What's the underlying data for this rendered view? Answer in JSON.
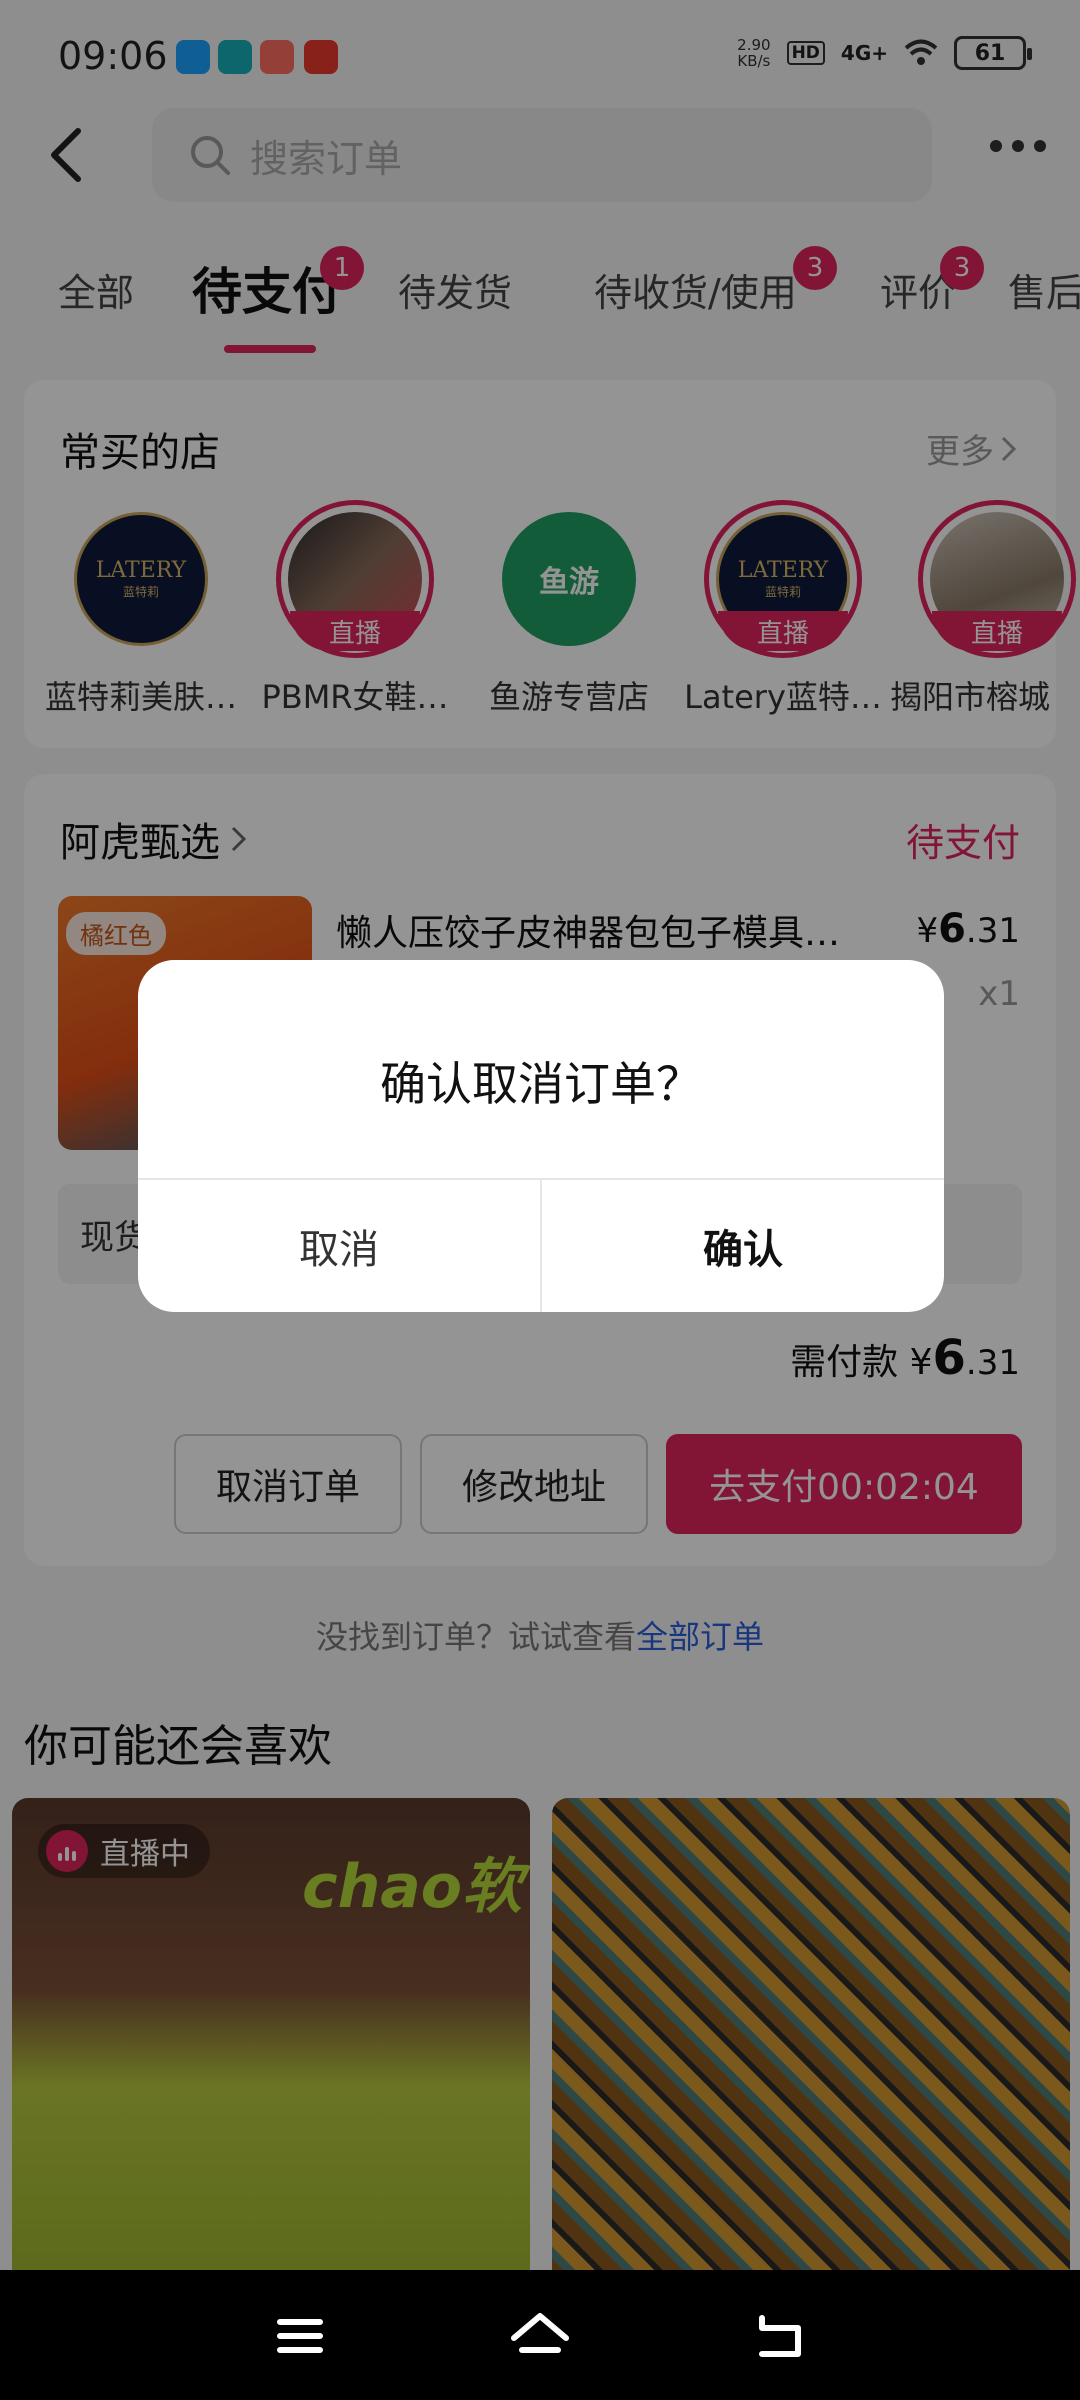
{
  "status_bar": {
    "time": "09:06",
    "net_speed_value": "2.90",
    "net_speed_unit": "KB/s",
    "hd": "HD",
    "signal": "4G+",
    "battery": "61"
  },
  "search": {
    "placeholder": "搜索订单"
  },
  "tabs": [
    {
      "label": "全部"
    },
    {
      "label": "待支付",
      "badge": "1"
    },
    {
      "label": "待发货"
    },
    {
      "label": "待收货/使用",
      "badge": "3"
    },
    {
      "label": "评价",
      "badge": "3"
    },
    {
      "label": "售后"
    }
  ],
  "frequent_stores": {
    "title": "常买的店",
    "more": "更多",
    "live_label": "直播",
    "stores": [
      {
        "name": "蓝特莉美肤…",
        "logo_text": "LATERY",
        "logo_sub": "蓝特莉",
        "live": false
      },
      {
        "name": "PBMR女鞋…",
        "live": true
      },
      {
        "name": "鱼游专营店",
        "logo_text": "鱼游",
        "live": false
      },
      {
        "name": "Latery蓝特…",
        "logo_text": "LATERY",
        "logo_sub": "蓝特莉",
        "live": true
      },
      {
        "name": "揭阳市榕城",
        "live": true
      }
    ]
  },
  "order": {
    "shop_name": "阿虎甄选",
    "status": "待支付",
    "product": {
      "color_tag": "橘红色",
      "title": "懒人压饺子皮神器包包子模具…",
      "price_symbol": "¥",
      "price_int": "6",
      "price_dec": ".31",
      "qty": "x1"
    },
    "stock_text": "现货",
    "total_label": "需付款",
    "total_symbol": "¥",
    "total_int": "6",
    "total_dec": ".31",
    "buttons": {
      "cancel_order": "取消订单",
      "change_address": "修改地址",
      "pay": "去支付00:02:04"
    }
  },
  "not_found": {
    "text": "没找到订单？试试查看",
    "link": "全部订单"
  },
  "recommend": {
    "title": "你可能还会喜欢",
    "live_chip": "直播中",
    "brand_text": "chao软"
  },
  "dialog": {
    "message": "确认取消订单？",
    "cancel": "取消",
    "confirm": "确认"
  },
  "colors": {
    "accent": "#e0245e",
    "link": "#2a5fd9"
  }
}
